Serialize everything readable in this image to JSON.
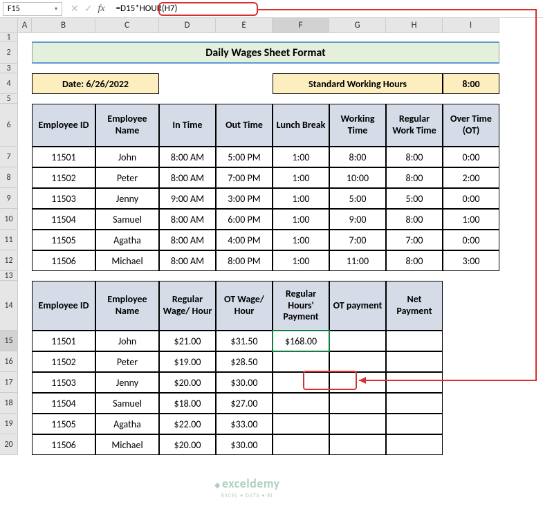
{
  "nameBox": "F15",
  "formula": "=D15*HOUR(H7)",
  "columns": [
    "A",
    "B",
    "C",
    "D",
    "E",
    "F",
    "G",
    "H",
    "I"
  ],
  "rows": [
    "1",
    "2",
    "3",
    "4",
    "5",
    "6",
    "7",
    "8",
    "9",
    "10",
    "11",
    "12",
    "13",
    "14",
    "15",
    "16",
    "17",
    "18",
    "19",
    "20"
  ],
  "title": "Daily Wages Sheet Format",
  "dateLabel": "Date: 6/26/2022",
  "stdHoursLabel": "Standard Working Hours",
  "stdHoursValue": "8:00",
  "table1": {
    "headers": [
      "Employee ID",
      "Employee Name",
      "In Time",
      "Out Time",
      "Lunch Break",
      "Working Time",
      "Regular Work Time",
      "Over Time (OT)"
    ],
    "rows": [
      [
        "11501",
        "John",
        "8:00 AM",
        "5:00 PM",
        "1:00",
        "8:00",
        "8:00",
        "0:00"
      ],
      [
        "11502",
        "Peter",
        "8:00 AM",
        "7:00 PM",
        "1:00",
        "10:00",
        "8:00",
        "2:00"
      ],
      [
        "11503",
        "Jenny",
        "9:00 AM",
        "3:00 PM",
        "1:00",
        "5:00",
        "5:00",
        "0:00"
      ],
      [
        "11504",
        "Samuel",
        "8:00 AM",
        "6:00 PM",
        "1:00",
        "9:00",
        "8:00",
        "1:00"
      ],
      [
        "11505",
        "Agatha",
        "8:00 AM",
        "4:00 PM",
        "1:00",
        "7:00",
        "7:00",
        "0:00"
      ],
      [
        "11506",
        "Michael",
        "8:00 AM",
        "8:00 PM",
        "1:00",
        "11:00",
        "8:00",
        "3:00"
      ]
    ]
  },
  "table2": {
    "headers": [
      "Employee ID",
      "Employee Name",
      "Regular Wage/ Hour",
      "OT Wage/ Hour",
      "Regular Hours' Payment",
      "OT payment",
      "Net Payment"
    ],
    "rows": [
      [
        "11501",
        "John",
        "$21.00",
        "$31.50",
        "$168.00",
        "",
        ""
      ],
      [
        "11502",
        "Peter",
        "$19.00",
        "$28.50",
        "",
        "",
        ""
      ],
      [
        "11503",
        "Jenny",
        "$20.00",
        "$30.00",
        "",
        "",
        ""
      ],
      [
        "11504",
        "Samuel",
        "$18.00",
        "$27.00",
        "",
        "",
        ""
      ],
      [
        "11505",
        "Agatha",
        "$22.00",
        "$33.00",
        "",
        "",
        ""
      ],
      [
        "11506",
        "Michael",
        "$20.00",
        "$30.00",
        "",
        "",
        ""
      ]
    ]
  },
  "watermark": {
    "brand": "exceldemy",
    "tagline": "EXCEL • DATA • BI"
  },
  "icons": {
    "dropdown": "▾",
    "cancel": "✕",
    "enter": "✓"
  }
}
